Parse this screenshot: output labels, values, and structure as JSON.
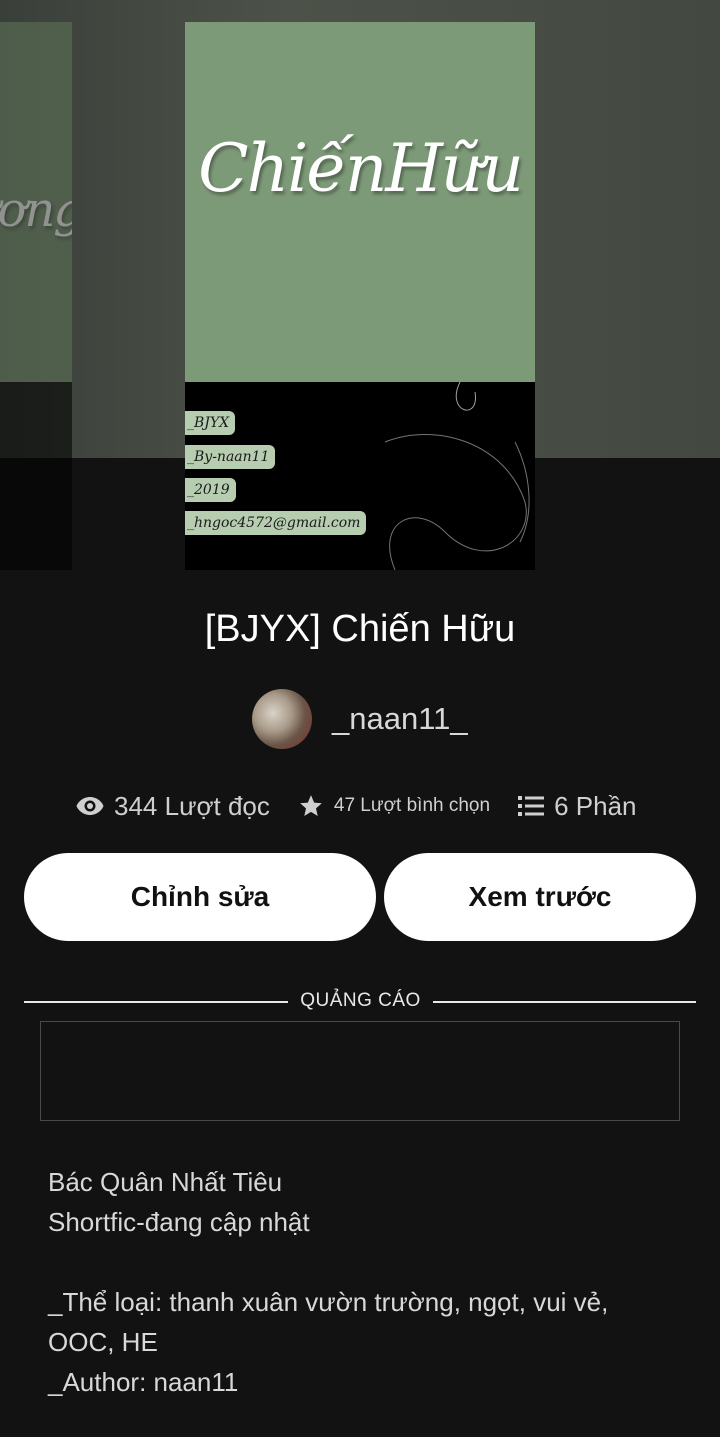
{
  "cover": {
    "title": "ChiếnHữu",
    "side_title": "ương",
    "tags": [
      "_BJYX",
      "_By-naan11",
      "_2019",
      "_hngoc4572@gmail.com"
    ]
  },
  "story": {
    "title": "[BJYX] Chiến Hữu",
    "author": "_naan11_"
  },
  "stats": {
    "reads": "344 Lượt đọc",
    "votes": "47 Lượt bình chọn",
    "parts": "6 Phần"
  },
  "buttons": {
    "edit": "Chỉnh sửa",
    "preview": "Xem trước"
  },
  "ad": {
    "label": "QUẢNG CÁO"
  },
  "description": {
    "lines": [
      "Bác Quân Nhất Tiêu",
      "Shortfic-đang cập nhật",
      "",
      "_Thể loại: thanh xuân vườn trường, ngọt, vui vẻ,",
      "OOC, HE",
      "_Author: naan11"
    ]
  }
}
